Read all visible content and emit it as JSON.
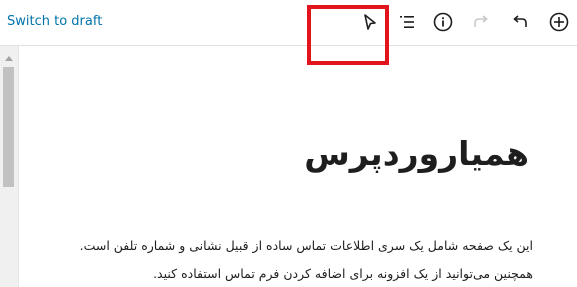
{
  "toolbar": {
    "switch_to_draft_label": "Switch to draft",
    "icons": [
      "add-block-icon",
      "undo-icon",
      "redo-icon",
      "info-icon",
      "list-view-icon",
      "select-tool-icon"
    ]
  },
  "editor": {
    "title": "همیاروردپرس",
    "paragraphs": [
      "این یک صفحه شامل یک سری اطلاعات تماس ساده از قبیل نشانی و شماره تلفن است.",
      "همچنین می‌توانید از یک افزونه برای اضافه کردن فرم تماس استفاده کنید."
    ]
  },
  "colors": {
    "link": "#0073aa",
    "highlight": "#e2131b",
    "icon": "#1e1e1e",
    "icon_disabled": "#c8c8c8"
  }
}
